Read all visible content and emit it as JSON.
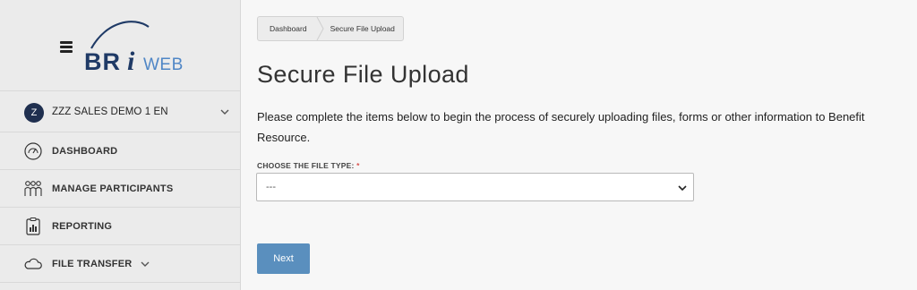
{
  "logo": {
    "text_bri": "BR",
    "text_i": "i",
    "text_web": "WEB"
  },
  "account": {
    "avatar_initial": "Z",
    "name": "ZZZ SALES DEMO 1 EN"
  },
  "sidebar": {
    "items": [
      {
        "label": "DASHBOARD",
        "icon": "speedometer-icon"
      },
      {
        "label": "MANAGE PARTICIPANTS",
        "icon": "people-icon"
      },
      {
        "label": "REPORTING",
        "icon": "clipboard-chart-icon"
      },
      {
        "label": "FILE TRANSFER",
        "icon": "cloud-icon"
      }
    ]
  },
  "breadcrumb": {
    "home": "Dashboard",
    "current": "Secure File Upload"
  },
  "page": {
    "title": "Secure File Upload",
    "intro": "Please complete the items below to begin the process of securely uploading files, forms or other information to Benefit Resource."
  },
  "form": {
    "file_type_label": "CHOOSE THE FILE TYPE:",
    "required_mark": "*",
    "file_type_value": "---",
    "next_label": "Next"
  },
  "colors": {
    "brand_navy": "#1f3a66",
    "brand_blue": "#4f86c6",
    "button_blue": "#5a8fbe",
    "avatar_bg": "#1f2f4f",
    "required_red": "#d9534f"
  }
}
